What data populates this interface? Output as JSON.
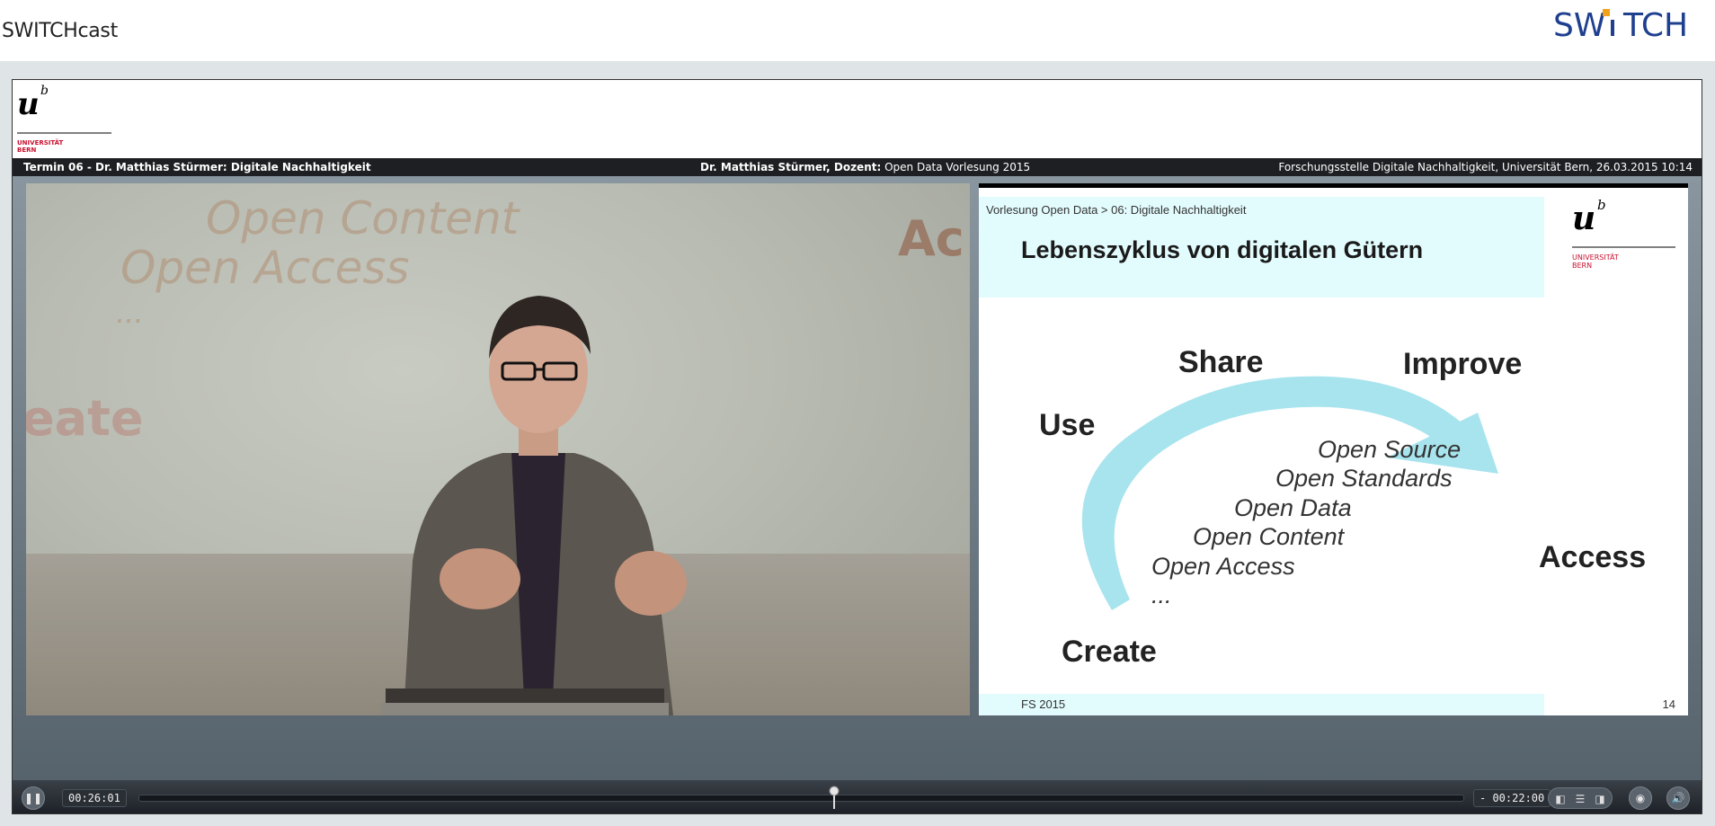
{
  "app": {
    "brand_text": "SWITCHcast",
    "logo_text_part1": "SW",
    "logo_text_part2": "TCH"
  },
  "header": {
    "university_logo_letter": "u",
    "university_logo_superscript": "b",
    "university_name_line1": "UNIVERSITÄT",
    "university_name_line2": "BERN"
  },
  "info_bar": {
    "left": "Termin 06 - Dr. Matthias Stürmer: Digitale Nachhaltigkeit",
    "center_bold": "Dr. Matthias Stürmer, Dozent:",
    "center_rest": " Open Data Vorlesung 2015",
    "right": "Forschungsstelle Digitale Nachhaltigkeit, Universität Bern, 26.03.2015 10:14"
  },
  "video": {
    "background_words": [
      "Open Content",
      "Open Access",
      "...",
      "eate",
      "Ac"
    ]
  },
  "slide": {
    "breadcrumb": "Vorlesung Open Data > 06: Digitale Nachhaltigkeit",
    "title": "Lebenszyklus von digitalen Gütern",
    "cycle_labels": {
      "share": "Share",
      "improve": "Improve",
      "use": "Use",
      "access": "Access",
      "create": "Create"
    },
    "open_items": [
      "Open Source",
      "Open Standards",
      "Open Data",
      "Open Content",
      "Open Access",
      "..."
    ],
    "footer": "FS 2015",
    "page_number": "14",
    "arrow_color": "#a8e4ee"
  },
  "controls": {
    "play_pause_icon": "pause-icon",
    "elapsed_time": "00:26:01",
    "remaining_time": "- 00:22:00",
    "progress": 0.525,
    "mode_icons": [
      "video-only-icon",
      "split-layout-icon",
      "slide-only-icon"
    ],
    "sync_icon": "eye-icon",
    "volume_icon": "speaker-icon"
  },
  "colors": {
    "switch_blue": "#1f3f8f",
    "switch_accent": "#f2a21b",
    "unibe_red": "#c8102e"
  }
}
